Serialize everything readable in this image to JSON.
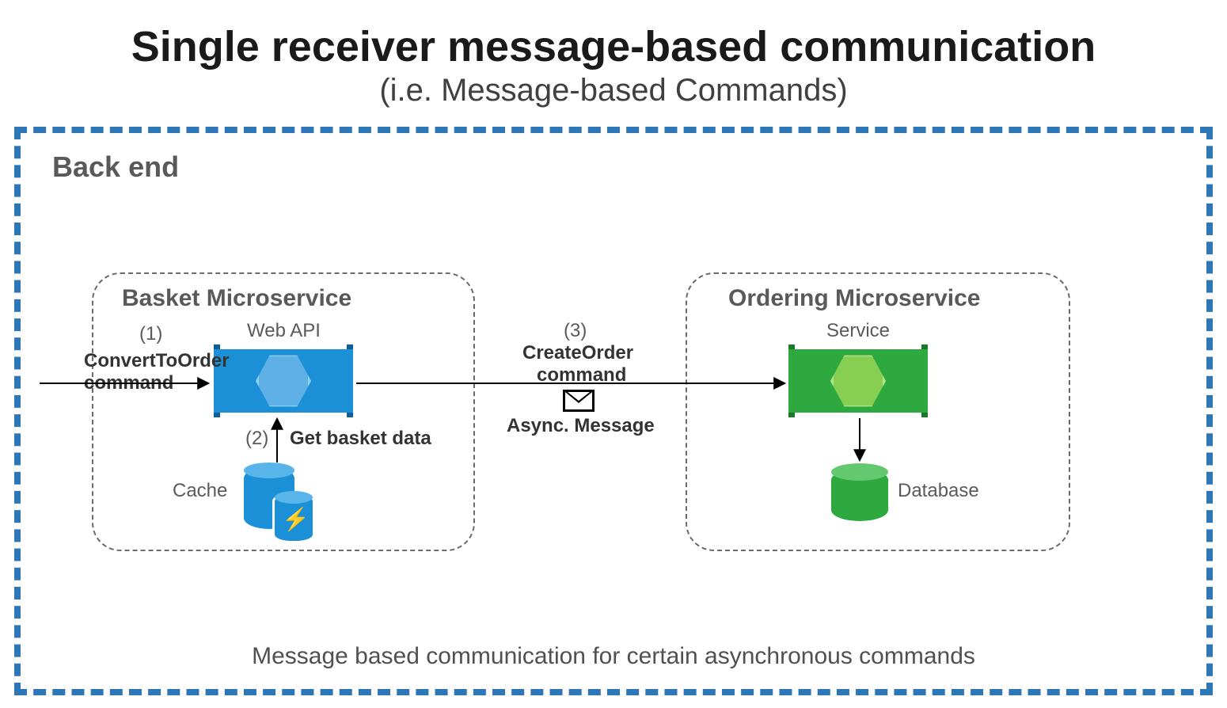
{
  "title": "Single receiver message-based communication",
  "subtitle": "(i.e. Message-based Commands)",
  "backend_label": "Back end",
  "footer": "Message based communication for certain asynchronous commands",
  "basket": {
    "title": "Basket Microservice",
    "web_api_label": "Web API",
    "cache_label": "Cache",
    "step1_num": "(1)",
    "step1_line1": "ConvertToOrder",
    "step1_line2": "command",
    "step2_num": "(2)",
    "step2_text": "Get basket data"
  },
  "middle": {
    "step3_num": "(3)",
    "step3_line1": "CreateOrder",
    "step3_line2": "command",
    "async_label": "Async. Message"
  },
  "ordering": {
    "title": "Ordering Microservice",
    "service_label": "Service",
    "database_label": "Database"
  },
  "colors": {
    "blue_border": "#2d77b7",
    "svc_blue": "#1b90d6",
    "svc_green": "#2ea93f"
  }
}
